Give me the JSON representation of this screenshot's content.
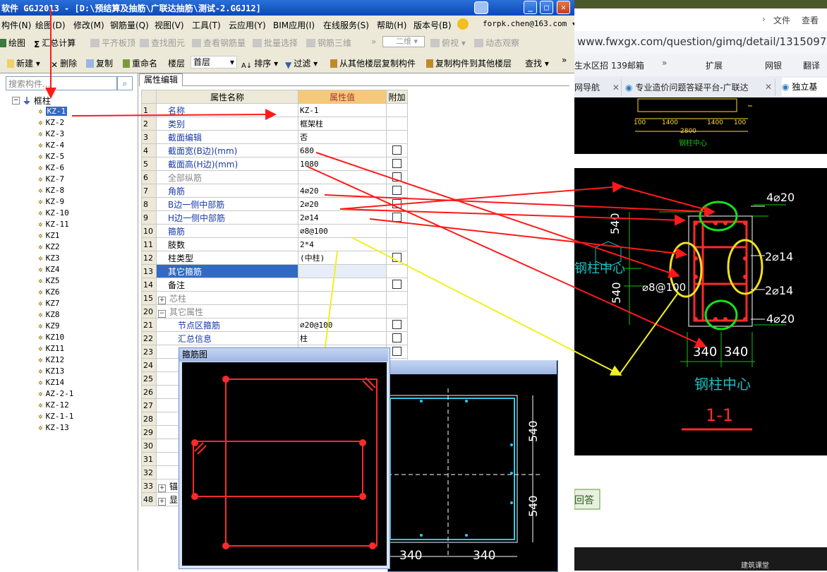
{
  "window": {
    "title": "软件 GGJ2013 - [D:\\预结算及抽筋\\广联达抽筋\\测试-2.GGJ12]"
  },
  "menu": [
    "构件(N)",
    "绘图(D)",
    "修改(M)",
    "钢筋量(Q)",
    "视图(V)",
    "工具(T)",
    "云应用(Y)",
    "BIM应用(I)",
    "在线服务(S)",
    "帮助(H)",
    "版本号(B)"
  ],
  "account": "forpk.chen@163.com",
  "toolbar1": {
    "draw": "绘图",
    "summary": "汇总计算",
    "flat_slab": "平齐板顶",
    "find_element": "查找图元",
    "view_rebar": "查看钢筋量",
    "batch_select": "批量选择",
    "rebar_3d": "钢筋三维",
    "view_mode": "二维",
    "overlook": "俯视",
    "dynamic": "动态观察"
  },
  "toolbar2": {
    "new": "新建",
    "delete": "删除",
    "copy": "复制",
    "rename": "重命名",
    "floor_label": "楼层",
    "floor_value": "首层",
    "sort": "排序",
    "filter": "过滤",
    "copy_from_floor": "从其他楼层复制构件",
    "copy_to_floor": "复制构件到其他楼层",
    "find": "查找"
  },
  "search": {
    "placeholder": "搜索构件..."
  },
  "tree": {
    "root": "框柱",
    "items": [
      "KZ-1",
      "KZ-2",
      "KZ-3",
      "KZ-4",
      "KZ-5",
      "KZ-6",
      "KZ-7",
      "KZ-8",
      "KZ-9",
      "KZ-10",
      "KZ-11",
      "KZ1",
      "KZ2",
      "KZ3",
      "KZ4",
      "KZ5",
      "KZ6",
      "KZ7",
      "KZ8",
      "KZ9",
      "KZ10",
      "KZ11",
      "KZ12",
      "KZ13",
      "KZ14",
      "AZ-2-1",
      "KZ-12",
      "KZ-1-1",
      "KZ-13"
    ]
  },
  "tab": "属性编辑",
  "grid": {
    "headers": [
      "属性名称",
      "属性值",
      "附加"
    ],
    "rows": [
      {
        "n": "1",
        "name": "名称",
        "value": "KZ-1"
      },
      {
        "n": "2",
        "name": "类别",
        "value": "框架柱"
      },
      {
        "n": "3",
        "name": "截面编辑",
        "value": "否"
      },
      {
        "n": "4",
        "name": "截面宽(B边)(mm)",
        "value": "680"
      },
      {
        "n": "5",
        "name": "截面高(H边)(mm)",
        "value": "1080"
      },
      {
        "n": "6",
        "name": "全部纵筋",
        "value": ""
      },
      {
        "n": "7",
        "name": "角筋",
        "value": "4⌀20"
      },
      {
        "n": "8",
        "name": "B边一侧中部筋",
        "value": "2⌀20"
      },
      {
        "n": "9",
        "name": "H边一侧中部筋",
        "value": "2⌀14"
      },
      {
        "n": "10",
        "name": "箍筋",
        "value": "⌀8@100"
      },
      {
        "n": "11",
        "name": "肢数",
        "value": "2*4"
      },
      {
        "n": "12",
        "name": "柱类型",
        "value": "(中柱)"
      },
      {
        "n": "13",
        "name": "其它箍筋",
        "value": ""
      },
      {
        "n": "14",
        "name": "备注",
        "value": ""
      },
      {
        "n": "15",
        "name": "芯柱",
        "value": ""
      },
      {
        "n": "20",
        "name": "其它属性",
        "value": ""
      },
      {
        "n": "21",
        "name": "节点区箍筋",
        "value": "⌀20@100"
      },
      {
        "n": "22",
        "name": "汇总信息",
        "value": "柱"
      },
      {
        "n": "23",
        "name": "",
        "value": ""
      },
      {
        "n": "24",
        "name": "",
        "value": ""
      },
      {
        "n": "25",
        "name": "",
        "value": ""
      },
      {
        "n": "26",
        "name": "",
        "value": ""
      },
      {
        "n": "27",
        "name": "",
        "value": ""
      },
      {
        "n": "28",
        "name": "",
        "value": ""
      },
      {
        "n": "29",
        "name": "",
        "value": ""
      },
      {
        "n": "30",
        "name": "",
        "value": ""
      },
      {
        "n": "31",
        "name": "",
        "value": ""
      },
      {
        "n": "32",
        "name": "",
        "value": ""
      },
      {
        "n": "33",
        "name": "锚",
        "value": ""
      },
      {
        "n": "48",
        "name": "显",
        "value": ""
      }
    ]
  },
  "popup": {
    "title": "箍筋图"
  },
  "drawing2": {
    "dim_b1": "340",
    "dim_b2": "340",
    "dim_h1": "540",
    "dim_h2": "540"
  },
  "browser": {
    "menu_file": "文件",
    "menu_view": "查看",
    "url": "www.fwxgx.com/question/gimq/detail/1315097.html#ar",
    "bm_water": "生水区招",
    "bm_139": "139邮箱",
    "bm_ext": "扩展",
    "bm_bank": "网银",
    "bm_trans": "翻译",
    "tab1": "网导航",
    "tab2": "专业造价问题答疑平台-广联达",
    "tab3": "独立基",
    "answer_btn": "回答",
    "footer_text": "建筑课堂"
  },
  "cad": {
    "d100a": "100",
    "d1400a": "1400",
    "d1400b": "1400",
    "d100b": "100",
    "d2800": "2800",
    "center_small": "钢柱中心",
    "r_corner_top": "4⌀20",
    "r_side1": "2⌀14",
    "r_side2": "2⌀14",
    "r_corner_bot": "4⌀20",
    "r_stirrup": "⌀8@100",
    "dim540a": "540",
    "dim540b": "540",
    "dim340a": "340",
    "dim340b": "340",
    "center_big": "钢柱中心",
    "center_left": "钢柱中心",
    "section": "1-1"
  },
  "colors": {
    "titlebar": "#0a49b8",
    "accent": "#316ac5",
    "panel": "#ece9d8",
    "cad_bg": "#000000"
  }
}
